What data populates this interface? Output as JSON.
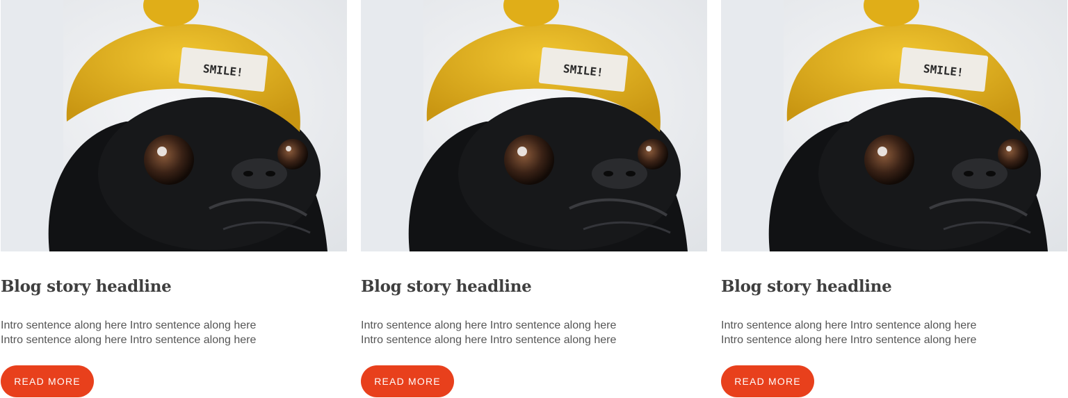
{
  "posts": [
    {
      "image_alt": "black pug wearing yellow knit beanie",
      "hat_label": "SMILE!",
      "headline": "Blog story headline",
      "intro_line1": "Intro sentence along here Intro sentence along here",
      "intro_line2": "Intro sentence along here Intro sentence along here",
      "button_label": "READ MORE"
    },
    {
      "image_alt": "black pug wearing yellow knit beanie",
      "hat_label": "SMILE!",
      "headline": "Blog story headline",
      "intro_line1": "Intro sentence along here Intro sentence along here",
      "intro_line2": "Intro sentence along here Intro sentence along here",
      "button_label": "READ MORE"
    },
    {
      "image_alt": "black pug wearing yellow knit beanie",
      "hat_label": "SMILE!",
      "headline": "Blog story headline",
      "intro_line1": "Intro sentence along here Intro sentence along here",
      "intro_line2": "Intro sentence along here Intro sentence along here",
      "button_label": "READ MORE"
    }
  ],
  "colors": {
    "button_bg": "#e8401c",
    "button_text": "#ffffff",
    "headline": "#3f3f3f",
    "body_text": "#555555",
    "hat_yellow": "#e3b21c"
  }
}
